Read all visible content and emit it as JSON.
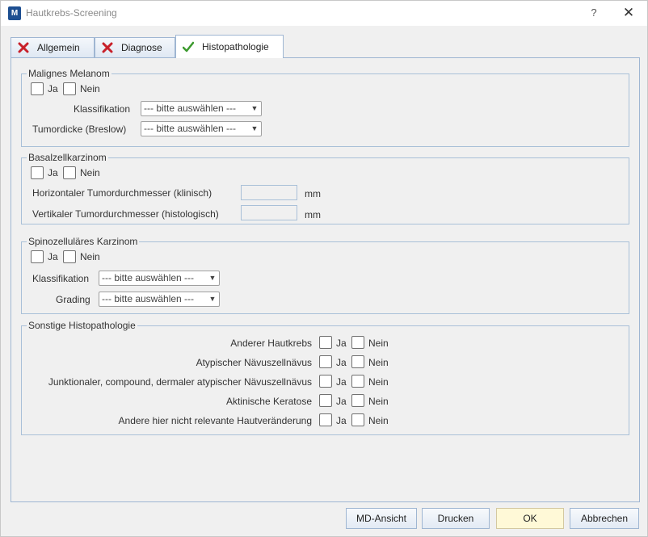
{
  "window": {
    "title": "Hautkrebs-Screening",
    "icon_text": "M",
    "help": "?",
    "close": "✕"
  },
  "tabs": [
    {
      "label": "Allgemein",
      "status_icon": "red-x-icon"
    },
    {
      "label": "Diagnose",
      "status_icon": "red-x-icon"
    },
    {
      "label": "Histopathologie",
      "status_icon": "green-check-icon",
      "active": true
    }
  ],
  "melanom": {
    "legend": "Malignes Melanom",
    "ja": "Ja",
    "nein": "Nein",
    "klassifikation_label": "Klassifikation",
    "klassifikation_value": "--- bitte auswählen ---",
    "tumordicke_label": "Tumordicke (Breslow)",
    "tumordicke_value": "--- bitte auswählen ---"
  },
  "basal": {
    "legend": "Basalzellkarzinom",
    "ja": "Ja",
    "nein": "Nein",
    "horizontal_label": "Horizontaler Tumordurchmesser (klinisch)",
    "horizontal_value": "",
    "horizontal_unit": "mm",
    "vertikal_label": "Vertikaler Tumordurchmesser (histologisch)",
    "vertikal_value": "",
    "vertikal_unit": "mm"
  },
  "spino": {
    "legend": "Spinozelluläres Karzinom",
    "ja": "Ja",
    "nein": "Nein",
    "klassifikation_label": "Klassifikation",
    "klassifikation_value": "--- bitte auswählen ---",
    "grading_label": "Grading",
    "grading_value": "--- bitte auswählen ---"
  },
  "sonstige": {
    "legend": "Sonstige Histopathologie",
    "rows": [
      {
        "label": "Anderer Hautkrebs",
        "ja": "Ja",
        "nein": "Nein"
      },
      {
        "label": "Atypischer Nävuszellnävus",
        "ja": "Ja",
        "nein": "Nein"
      },
      {
        "label": "Junktionaler, compound, dermaler atypischer Nävuszellnävus",
        "ja": "Ja",
        "nein": "Nein"
      },
      {
        "label": "Aktinische Keratose",
        "ja": "Ja",
        "nein": "Nein"
      },
      {
        "label": "Andere hier nicht relevante Hautveränderung",
        "ja": "Ja",
        "nein": "Nein"
      }
    ]
  },
  "buttons": {
    "md_ansicht": "MD-Ansicht",
    "drucken": "Drucken",
    "ok": "OK",
    "abbrechen": "Abbrechen"
  },
  "colors": {
    "tab_border": "#9fb6d2",
    "ok_button": "#fff9d7",
    "error_icon": "#c8202a",
    "check_icon": "#3c9a2e"
  }
}
